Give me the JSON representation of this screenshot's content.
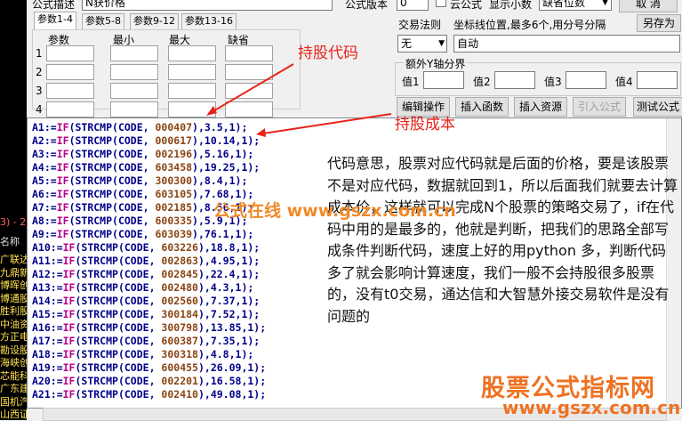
{
  "form": {
    "desc_label": "公式描述",
    "desc_value": "N获价格",
    "version_label": "公式版本",
    "version_value": "0",
    "cloud_label": "云公式",
    "decimals_label": "显示小数",
    "decimals_value": "缺省位数",
    "cancel_label": "取 消",
    "save_as_label": "另存为"
  },
  "tabs": [
    "参数1-4",
    "参数5-8",
    "参数9-12",
    "参数13-16"
  ],
  "param_headers": [
    "参数",
    "最小",
    "最大",
    "缺省"
  ],
  "param_rows": [
    "1",
    "2",
    "3",
    "4"
  ],
  "trade_rule_label": "交易法则",
  "trade_rule_value": "无",
  "coord_label": "坐标线位置,最多6个,用分号分隔",
  "coord_value": "自动",
  "yaxis": {
    "label": "额外Y轴分界",
    "items": [
      "值1",
      "值2",
      "值3",
      "值4"
    ]
  },
  "toolbar": [
    "编辑操作",
    "插入函数",
    "插入资源",
    "引入公式",
    "测试公式"
  ],
  "code_lines": [
    {
      "var": "A1",
      "code": "000407",
      "val": "3.5"
    },
    {
      "var": "A2",
      "code": "000617",
      "val": "10.14"
    },
    {
      "var": "A3",
      "code": "002196",
      "val": "5.16"
    },
    {
      "var": "A4",
      "code": "603458",
      "val": "19.25"
    },
    {
      "var": "A5",
      "code": "300300",
      "val": "8.4"
    },
    {
      "var": "A6",
      "code": "603105",
      "val": "7.68"
    },
    {
      "var": "A7",
      "code": "002185",
      "val": "8.56"
    },
    {
      "var": "A8",
      "code": "600335",
      "val": "5.9"
    },
    {
      "var": "A9",
      "code": "603039",
      "val": "76.1"
    },
    {
      "var": "A10",
      "code": "603226",
      "val": "18.8"
    },
    {
      "var": "A11",
      "code": "002863",
      "val": "4.95"
    },
    {
      "var": "A12",
      "code": "002845",
      "val": "22.4"
    },
    {
      "var": "A13",
      "code": "002480",
      "val": "4.3"
    },
    {
      "var": "A14",
      "code": "002560",
      "val": "7.37"
    },
    {
      "var": "A15",
      "code": "300184",
      "val": "7.52"
    },
    {
      "var": "A16",
      "code": "300798",
      "val": "13.85"
    },
    {
      "var": "A17",
      "code": "600387",
      "val": "7.35"
    },
    {
      "var": "A18",
      "code": "300318",
      "val": "4.8"
    },
    {
      "var": "A19",
      "code": "600455",
      "val": "26.09"
    },
    {
      "var": "A20",
      "code": "002201",
      "val": "16.58"
    },
    {
      "var": "A21",
      "code": "002410",
      "val": "49.08"
    }
  ],
  "annotations": {
    "stock_code": "持股代码",
    "stock_cost": "持股成本",
    "explanation": "代码意思，股票对应代码就是后面的价格，要是该股票不是对应代码，数据就回到1，所以后面我们就要去计算成本价，这样就可以完成N个股票的策略交易了，if在代码中用的是最多的，他就是判断，把我们的思路全部写成条件判断代码，速度上好的用python 多，判断代码多了就会影响计算速度，我们一般不会持股很多股票的，没有t0交易，通达信和大智慧外接交易软件是没有问题的",
    "watermark_mid": "公式在线 www.gszx.com.cn"
  },
  "watermark": {
    "title": "股票公式指标网",
    "url": "www.gszx.com.cn"
  },
  "left_panel": {
    "header": "3) - 21",
    "name_label": "名称",
    "stocks": [
      "广联达",
      "九鼎新",
      "博晖创",
      "博通股",
      "胜利股",
      "中油资",
      "方正电",
      "勘设股",
      "海峡创",
      "芯能科",
      "广东建",
      "国机汽",
      "山西证"
    ]
  },
  "colors": {
    "annotation_red": "#e8231a",
    "code_blue": "#00008b",
    "string_brown": "#8b4513",
    "watermark_orange": "#ef7f1a"
  }
}
